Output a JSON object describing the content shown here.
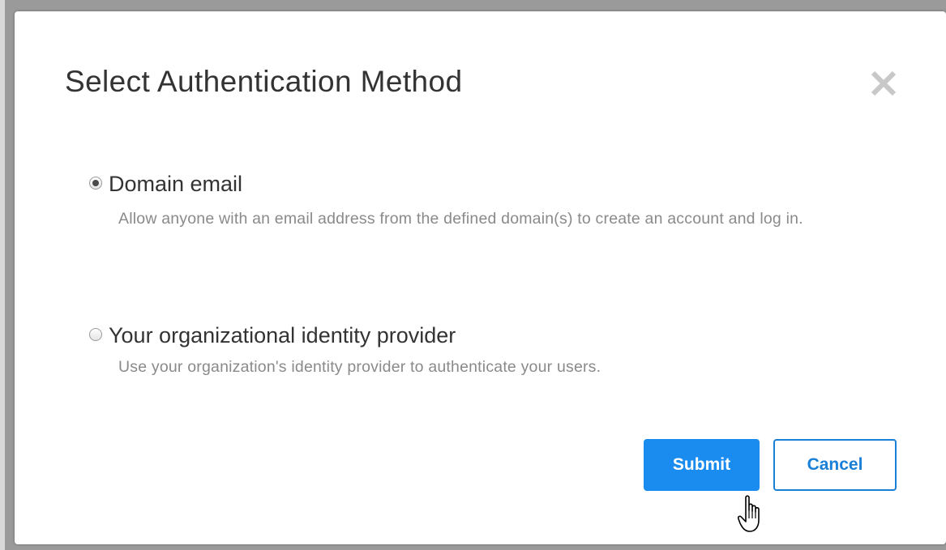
{
  "dialog": {
    "title": "Select Authentication Method",
    "close_icon": "close-icon"
  },
  "options": [
    {
      "label": "Domain email",
      "description": "Allow anyone with an email address from the defined domain(s) to create an account and log in.",
      "checked": true
    },
    {
      "label": "Your organizational identity provider",
      "description": "Use your organization's identity provider to authenticate your users.",
      "checked": false
    }
  ],
  "buttons": {
    "submit_label": "Submit",
    "cancel_label": "Cancel"
  },
  "colors": {
    "primary": "#1a8cf0",
    "title_text": "#333333",
    "description_text": "#8a8a8a"
  },
  "icons": {
    "cursor": "hand-pointer-icon"
  }
}
